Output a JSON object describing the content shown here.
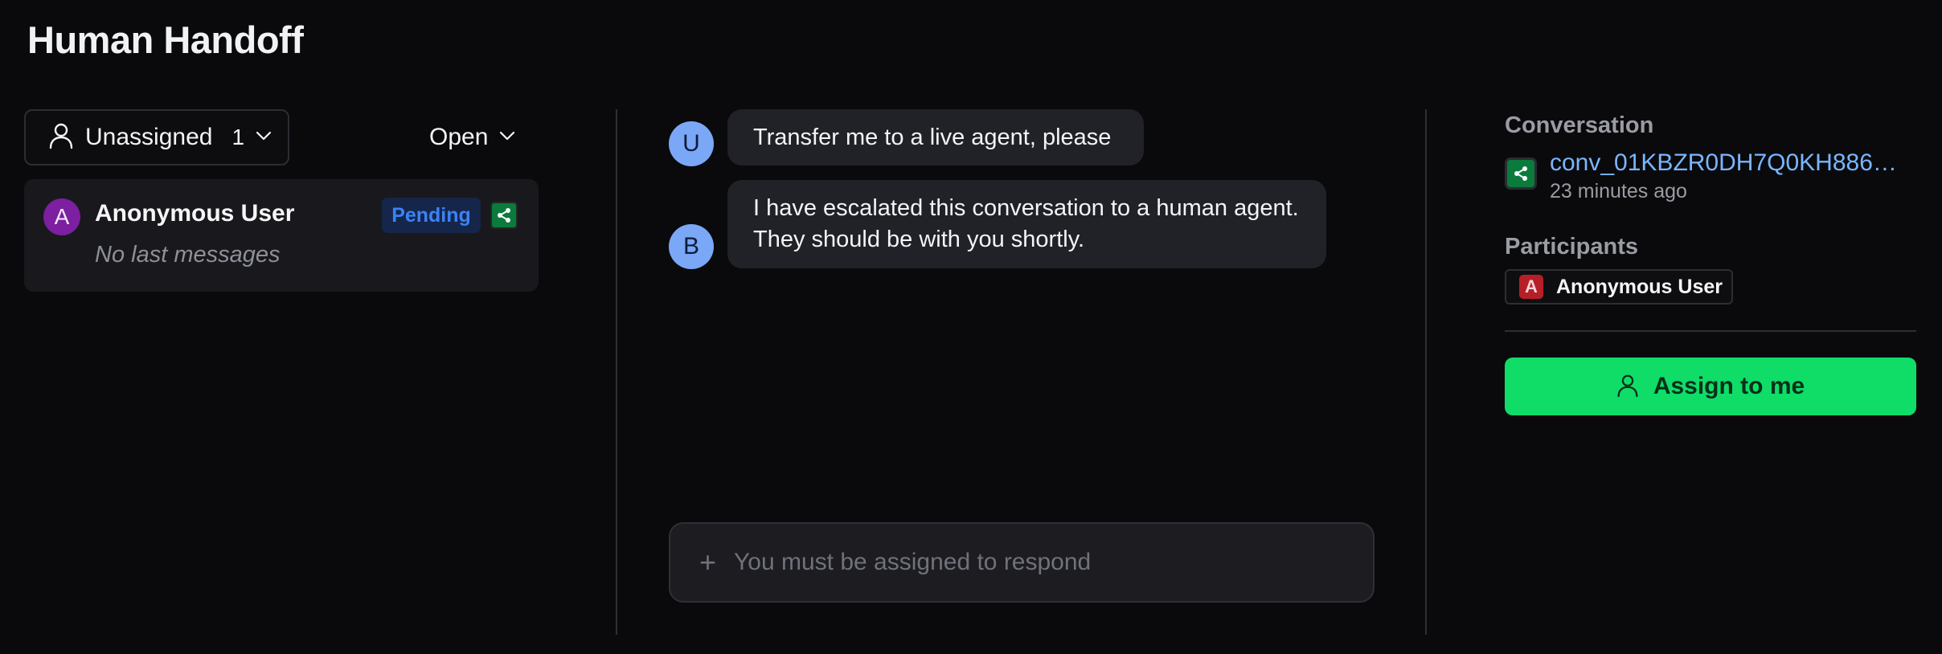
{
  "page": {
    "title": "Human Handoff"
  },
  "inbox": {
    "assignee_filter": {
      "label": "Unassigned",
      "count": "1",
      "icon": "user-icon"
    },
    "status_filter": {
      "label": "Open"
    },
    "conversations": [
      {
        "avatar_letter": "A",
        "name": "Anonymous User",
        "last_message": "No last messages",
        "status": "Pending",
        "channel_icon": "share-icon"
      }
    ]
  },
  "chat": {
    "messages": [
      {
        "sender_letter": "U",
        "text": "Transfer me to a live agent, please"
      },
      {
        "sender_letter": "B",
        "text": "I have escalated this conversation to a human agent. They should be with you shortly."
      }
    ],
    "composer": {
      "placeholder": "You must be assigned to respond",
      "attach_icon": "plus-icon"
    }
  },
  "details": {
    "conversation_label": "Conversation",
    "conversation_id": "conv_01KBZR0DH7Q0KH886DJ...",
    "conversation_time": "23 minutes ago",
    "participants_label": "Participants",
    "participants": [
      {
        "avatar_letter": "A",
        "name": "Anonymous User"
      }
    ],
    "assign_button": {
      "label": "Assign to me",
      "icon": "user-icon"
    }
  },
  "colors": {
    "background": "#0a0a0c",
    "accent_green": "#0fdd68",
    "link_blue": "#7ab6ff",
    "pending_blue": "#3b82f6",
    "user_avatar_purple": "#7c1fa0",
    "participant_red": "#b51f28"
  }
}
